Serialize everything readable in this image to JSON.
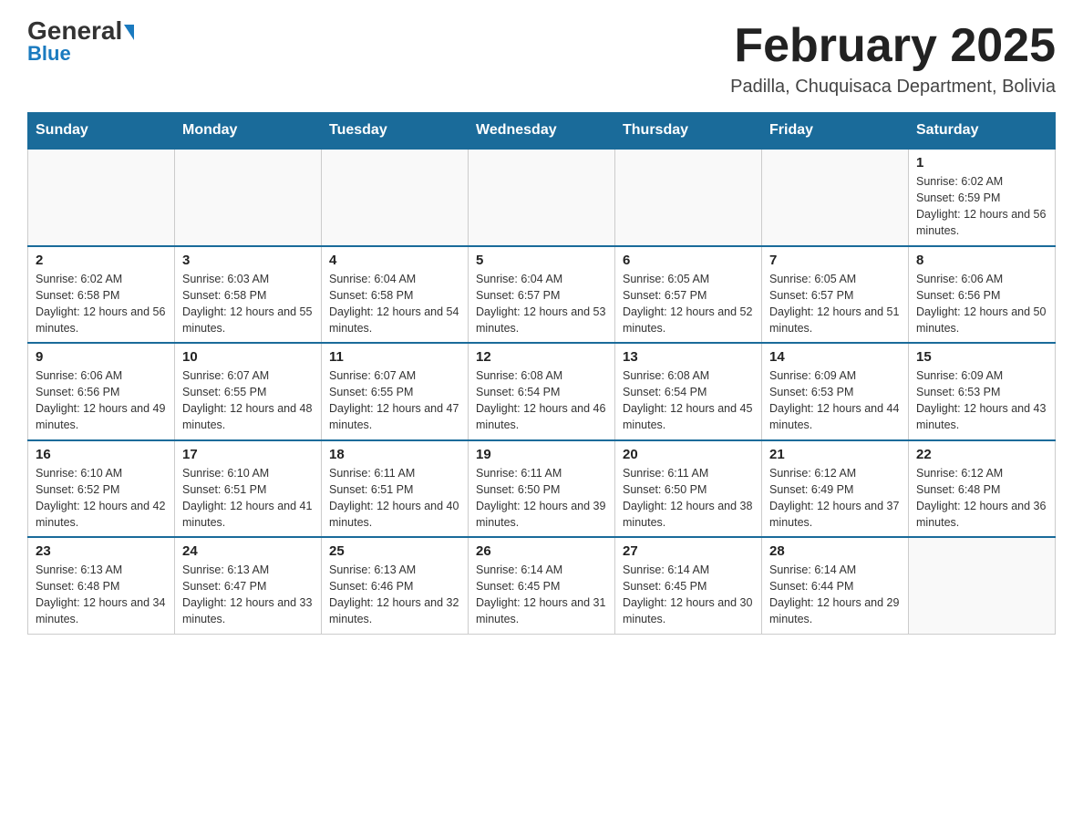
{
  "header": {
    "logo_main": "General",
    "logo_sub": "Blue",
    "month_title": "February 2025",
    "location": "Padilla, Chuquisaca Department, Bolivia"
  },
  "days_of_week": [
    "Sunday",
    "Monday",
    "Tuesday",
    "Wednesday",
    "Thursday",
    "Friday",
    "Saturday"
  ],
  "weeks": [
    [
      {
        "day": "",
        "sunrise": "",
        "sunset": "",
        "daylight": ""
      },
      {
        "day": "",
        "sunrise": "",
        "sunset": "",
        "daylight": ""
      },
      {
        "day": "",
        "sunrise": "",
        "sunset": "",
        "daylight": ""
      },
      {
        "day": "",
        "sunrise": "",
        "sunset": "",
        "daylight": ""
      },
      {
        "day": "",
        "sunrise": "",
        "sunset": "",
        "daylight": ""
      },
      {
        "day": "",
        "sunrise": "",
        "sunset": "",
        "daylight": ""
      },
      {
        "day": "1",
        "sunrise": "Sunrise: 6:02 AM",
        "sunset": "Sunset: 6:59 PM",
        "daylight": "Daylight: 12 hours and 56 minutes."
      }
    ],
    [
      {
        "day": "2",
        "sunrise": "Sunrise: 6:02 AM",
        "sunset": "Sunset: 6:58 PM",
        "daylight": "Daylight: 12 hours and 56 minutes."
      },
      {
        "day": "3",
        "sunrise": "Sunrise: 6:03 AM",
        "sunset": "Sunset: 6:58 PM",
        "daylight": "Daylight: 12 hours and 55 minutes."
      },
      {
        "day": "4",
        "sunrise": "Sunrise: 6:04 AM",
        "sunset": "Sunset: 6:58 PM",
        "daylight": "Daylight: 12 hours and 54 minutes."
      },
      {
        "day": "5",
        "sunrise": "Sunrise: 6:04 AM",
        "sunset": "Sunset: 6:57 PM",
        "daylight": "Daylight: 12 hours and 53 minutes."
      },
      {
        "day": "6",
        "sunrise": "Sunrise: 6:05 AM",
        "sunset": "Sunset: 6:57 PM",
        "daylight": "Daylight: 12 hours and 52 minutes."
      },
      {
        "day": "7",
        "sunrise": "Sunrise: 6:05 AM",
        "sunset": "Sunset: 6:57 PM",
        "daylight": "Daylight: 12 hours and 51 minutes."
      },
      {
        "day": "8",
        "sunrise": "Sunrise: 6:06 AM",
        "sunset": "Sunset: 6:56 PM",
        "daylight": "Daylight: 12 hours and 50 minutes."
      }
    ],
    [
      {
        "day": "9",
        "sunrise": "Sunrise: 6:06 AM",
        "sunset": "Sunset: 6:56 PM",
        "daylight": "Daylight: 12 hours and 49 minutes."
      },
      {
        "day": "10",
        "sunrise": "Sunrise: 6:07 AM",
        "sunset": "Sunset: 6:55 PM",
        "daylight": "Daylight: 12 hours and 48 minutes."
      },
      {
        "day": "11",
        "sunrise": "Sunrise: 6:07 AM",
        "sunset": "Sunset: 6:55 PM",
        "daylight": "Daylight: 12 hours and 47 minutes."
      },
      {
        "day": "12",
        "sunrise": "Sunrise: 6:08 AM",
        "sunset": "Sunset: 6:54 PM",
        "daylight": "Daylight: 12 hours and 46 minutes."
      },
      {
        "day": "13",
        "sunrise": "Sunrise: 6:08 AM",
        "sunset": "Sunset: 6:54 PM",
        "daylight": "Daylight: 12 hours and 45 minutes."
      },
      {
        "day": "14",
        "sunrise": "Sunrise: 6:09 AM",
        "sunset": "Sunset: 6:53 PM",
        "daylight": "Daylight: 12 hours and 44 minutes."
      },
      {
        "day": "15",
        "sunrise": "Sunrise: 6:09 AM",
        "sunset": "Sunset: 6:53 PM",
        "daylight": "Daylight: 12 hours and 43 minutes."
      }
    ],
    [
      {
        "day": "16",
        "sunrise": "Sunrise: 6:10 AM",
        "sunset": "Sunset: 6:52 PM",
        "daylight": "Daylight: 12 hours and 42 minutes."
      },
      {
        "day": "17",
        "sunrise": "Sunrise: 6:10 AM",
        "sunset": "Sunset: 6:51 PM",
        "daylight": "Daylight: 12 hours and 41 minutes."
      },
      {
        "day": "18",
        "sunrise": "Sunrise: 6:11 AM",
        "sunset": "Sunset: 6:51 PM",
        "daylight": "Daylight: 12 hours and 40 minutes."
      },
      {
        "day": "19",
        "sunrise": "Sunrise: 6:11 AM",
        "sunset": "Sunset: 6:50 PM",
        "daylight": "Daylight: 12 hours and 39 minutes."
      },
      {
        "day": "20",
        "sunrise": "Sunrise: 6:11 AM",
        "sunset": "Sunset: 6:50 PM",
        "daylight": "Daylight: 12 hours and 38 minutes."
      },
      {
        "day": "21",
        "sunrise": "Sunrise: 6:12 AM",
        "sunset": "Sunset: 6:49 PM",
        "daylight": "Daylight: 12 hours and 37 minutes."
      },
      {
        "day": "22",
        "sunrise": "Sunrise: 6:12 AM",
        "sunset": "Sunset: 6:48 PM",
        "daylight": "Daylight: 12 hours and 36 minutes."
      }
    ],
    [
      {
        "day": "23",
        "sunrise": "Sunrise: 6:13 AM",
        "sunset": "Sunset: 6:48 PM",
        "daylight": "Daylight: 12 hours and 34 minutes."
      },
      {
        "day": "24",
        "sunrise": "Sunrise: 6:13 AM",
        "sunset": "Sunset: 6:47 PM",
        "daylight": "Daylight: 12 hours and 33 minutes."
      },
      {
        "day": "25",
        "sunrise": "Sunrise: 6:13 AM",
        "sunset": "Sunset: 6:46 PM",
        "daylight": "Daylight: 12 hours and 32 minutes."
      },
      {
        "day": "26",
        "sunrise": "Sunrise: 6:14 AM",
        "sunset": "Sunset: 6:45 PM",
        "daylight": "Daylight: 12 hours and 31 minutes."
      },
      {
        "day": "27",
        "sunrise": "Sunrise: 6:14 AM",
        "sunset": "Sunset: 6:45 PM",
        "daylight": "Daylight: 12 hours and 30 minutes."
      },
      {
        "day": "28",
        "sunrise": "Sunrise: 6:14 AM",
        "sunset": "Sunset: 6:44 PM",
        "daylight": "Daylight: 12 hours and 29 minutes."
      },
      {
        "day": "",
        "sunrise": "",
        "sunset": "",
        "daylight": ""
      }
    ]
  ]
}
